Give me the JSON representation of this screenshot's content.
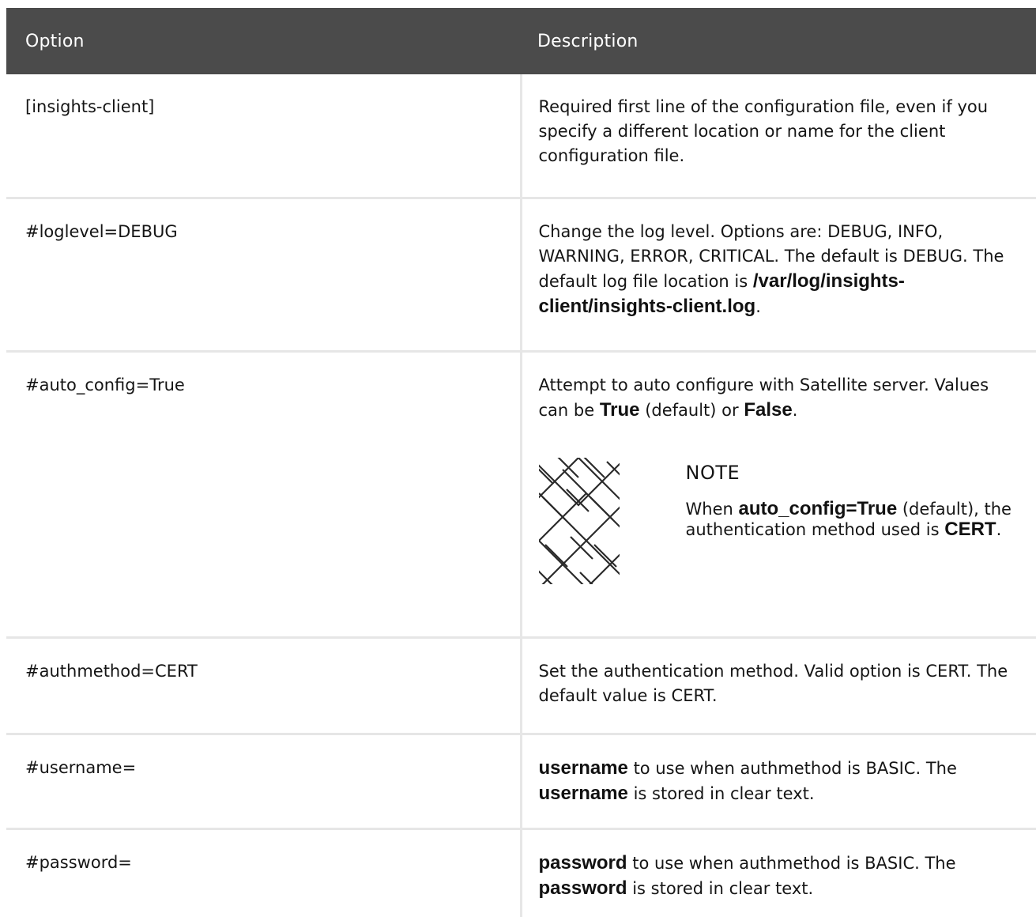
{
  "headers": {
    "option": "Option",
    "description": "Description"
  },
  "rows": [
    {
      "option": "[insights-client]",
      "desc": "Required first line of the configuration file, even if you specify a different location or name for the client configuration file."
    },
    {
      "option": "#loglevel=DEBUG",
      "desc_a": "Change the log level. Options are: DEBUG, INFO, WARNING, ERROR, CRITICAL. The default is DEBUG. The default log file location is ",
      "desc_b": "/var/log/insights-client/insights-client.log",
      "desc_c": "."
    },
    {
      "option": "#auto_config=True",
      "desc_a": "Attempt to auto configure with Satellite server. Values can be ",
      "desc_b": "True",
      "desc_c": " (default) or ",
      "desc_d": "False",
      "desc_e": ".",
      "note": {
        "icon": "note-pattern-icon",
        "title": "NOTE",
        "text_a": "When ",
        "text_b": "auto_config=True",
        "text_c": " (default), the authentication method used is ",
        "text_d": "CERT",
        "text_e": "."
      }
    },
    {
      "option": "#authmethod=CERT",
      "desc": "Set the authentication method. Valid option is CERT. The default value is CERT."
    },
    {
      "option": "#username=",
      "desc_a": "username",
      "desc_b": " to use when authmethod is BASIC. The ",
      "desc_c": "username",
      "desc_d": " is stored in clear text."
    },
    {
      "option": "#password=",
      "desc_a": "password",
      "desc_b": " to use when authmethod is BASIC. The ",
      "desc_c": "password",
      "desc_d": " is stored in clear text."
    }
  ]
}
